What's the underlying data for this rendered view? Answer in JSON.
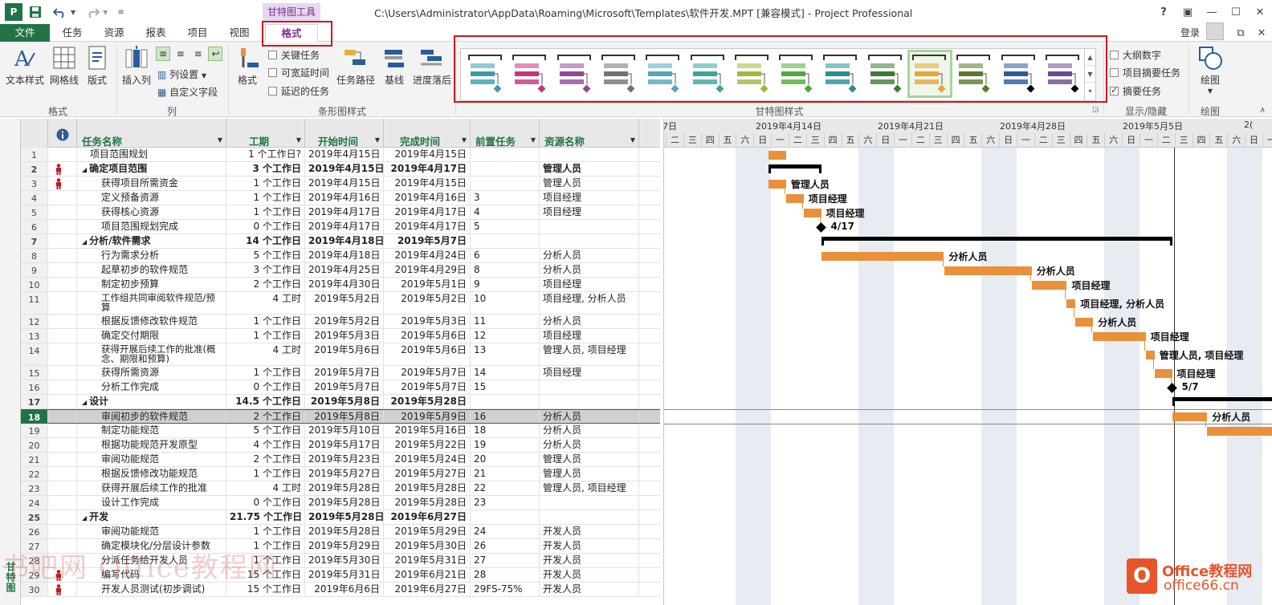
{
  "window": {
    "title": "C:\\Users\\Administrator\\AppData\\Roaming\\Microsoft\\Templates\\软件开发.MPT [兼容模式] - Project Professional",
    "context_tool": "甘特图工具",
    "help": "?",
    "login": "登录"
  },
  "tabs": [
    "文件",
    "任务",
    "资源",
    "报表",
    "项目",
    "视图",
    "格式"
  ],
  "ribbon": {
    "format_group": {
      "label": "格式",
      "text_styles": "文本样式",
      "gridlines": "网格线",
      "layout": "版式"
    },
    "columns_group": {
      "label": "列",
      "insert_column": "插入列",
      "column_settings": "列设置",
      "custom_fields": "自定义字段"
    },
    "bar_styles_group": {
      "label": "条形图样式",
      "format": "格式",
      "critical_tasks": "关键任务",
      "slack": "可宽延时间",
      "late_tasks": "延迟的任务",
      "task_path": "任务路径",
      "baseline": "基线",
      "slippage": "进度落后"
    },
    "gantt_styles_group": {
      "label": "甘特图样式"
    },
    "show_hide_group": {
      "label": "显示/隐藏",
      "outline_number": "大纲数字",
      "project_summary": "项目摘要任务",
      "summary_tasks": "摘要任务"
    },
    "drawings_group": {
      "label": "绘图",
      "drawing": "绘图"
    }
  },
  "gallery_colors": [
    "#3a9ea8",
    "#c4367c",
    "#8e4a9a",
    "#737373",
    "#54a7b3",
    "#3aa69a",
    "#9fb83a",
    "#4ea93a",
    "#2b8f92",
    "#3d7a3a",
    "#e9a53a",
    "#5a7a28",
    "#2c5a9a",
    "#6d4a8f"
  ],
  "side_label": "甘特图",
  "grid_headers": [
    "任务名称",
    "工期",
    "开始时间",
    "完成时间",
    "前置任务",
    "资源名称"
  ],
  "tasks": [
    {
      "id": "1",
      "name": "项目范围规划",
      "dur": "1 个工作日?",
      "start": "2019年4月15日",
      "finish": "2019年4月15日",
      "pred": "",
      "res": ""
    },
    {
      "id": "2",
      "name": "确定项目范围",
      "dur": "3 个工作日",
      "start": "2019年4月15日",
      "finish": "2019年4月17日",
      "pred": "",
      "res": "管理人员"
    },
    {
      "id": "3",
      "name": "获得项目所需资金",
      "dur": "1 个工作日",
      "start": "2019年4月15日",
      "finish": "2019年4月15日",
      "pred": "",
      "res": "管理人员"
    },
    {
      "id": "4",
      "name": "定义预备资源",
      "dur": "1 个工作日",
      "start": "2019年4月16日",
      "finish": "2019年4月16日",
      "pred": "3",
      "res": "项目经理"
    },
    {
      "id": "5",
      "name": "获得核心资源",
      "dur": "1 个工作日",
      "start": "2019年4月17日",
      "finish": "2019年4月17日",
      "pred": "4",
      "res": "项目经理"
    },
    {
      "id": "6",
      "name": "项目范围规划完成",
      "dur": "0 个工作日",
      "start": "2019年4月17日",
      "finish": "2019年4月17日",
      "pred": "5",
      "res": ""
    },
    {
      "id": "7",
      "name": "分析/软件需求",
      "dur": "14 个工作日",
      "start": "2019年4月18日",
      "finish": "2019年5月7日",
      "pred": "",
      "res": ""
    },
    {
      "id": "8",
      "name": "行为需求分析",
      "dur": "5 个工作日",
      "start": "2019年4月18日",
      "finish": "2019年4月24日",
      "pred": "6",
      "res": "分析人员"
    },
    {
      "id": "9",
      "name": "起草初步的软件规范",
      "dur": "3 个工作日",
      "start": "2019年4月25日",
      "finish": "2019年4月29日",
      "pred": "8",
      "res": "分析人员"
    },
    {
      "id": "10",
      "name": "制定初步预算",
      "dur": "2 个工作日",
      "start": "2019年4月30日",
      "finish": "2019年5月1日",
      "pred": "9",
      "res": "项目经理"
    },
    {
      "id": "11",
      "name": "工作组共同审阅软件规范/预算",
      "dur": "4 工时",
      "start": "2019年5月2日",
      "finish": "2019年5月2日",
      "pred": "10",
      "res": "项目经理, 分析人员"
    },
    {
      "id": "12",
      "name": "根据反馈修改软件规范",
      "dur": "1 个工作日",
      "start": "2019年5月2日",
      "finish": "2019年5月3日",
      "pred": "11",
      "res": "分析人员"
    },
    {
      "id": "13",
      "name": "确定交付期限",
      "dur": "1 个工作日",
      "start": "2019年5月3日",
      "finish": "2019年5月6日",
      "pred": "12",
      "res": "项目经理"
    },
    {
      "id": "14",
      "name": "获得开展后续工作的批准(概念、期限和预算)",
      "dur": "4 工时",
      "start": "2019年5月6日",
      "finish": "2019年5月6日",
      "pred": "13",
      "res": "管理人员, 项目经理"
    },
    {
      "id": "15",
      "name": "获得所需资源",
      "dur": "1 个工作日",
      "start": "2019年5月7日",
      "finish": "2019年5月7日",
      "pred": "14",
      "res": "项目经理"
    },
    {
      "id": "16",
      "name": "分析工作完成",
      "dur": "0 个工作日",
      "start": "2019年5月7日",
      "finish": "2019年5月7日",
      "pred": "15",
      "res": ""
    },
    {
      "id": "17",
      "name": "设计",
      "dur": "14.5 个工作日",
      "start": "2019年5月8日",
      "finish": "2019年5月28日",
      "pred": "",
      "res": ""
    },
    {
      "id": "18",
      "name": "审阅初步的软件规范",
      "dur": "2 个工作日",
      "start": "2019年5月8日",
      "finish": "2019年5月9日",
      "pred": "16",
      "res": "分析人员"
    },
    {
      "id": "19",
      "name": "制定功能规范",
      "dur": "5 个工作日",
      "start": "2019年5月10日",
      "finish": "2019年5月16日",
      "pred": "18",
      "res": "分析人员"
    },
    {
      "id": "20",
      "name": "根据功能规范开发原型",
      "dur": "4 个工作日",
      "start": "2019年5月17日",
      "finish": "2019年5月22日",
      "pred": "19",
      "res": "分析人员"
    },
    {
      "id": "21",
      "name": "审阅功能规范",
      "dur": "2 个工作日",
      "start": "2019年5月23日",
      "finish": "2019年5月24日",
      "pred": "20",
      "res": "管理人员"
    },
    {
      "id": "22",
      "name": "根据反馈修改功能规范",
      "dur": "1 个工作日",
      "start": "2019年5月27日",
      "finish": "2019年5月27日",
      "pred": "21",
      "res": "管理人员"
    },
    {
      "id": "23",
      "name": "获得开展后续工作的批准",
      "dur": "4 工时",
      "start": "2019年5月28日",
      "finish": "2019年5月28日",
      "pred": "22",
      "res": "管理人员, 项目经理"
    },
    {
      "id": "24",
      "name": "设计工作完成",
      "dur": "0 个工作日",
      "start": "2019年5月28日",
      "finish": "2019年5月28日",
      "pred": "23",
      "res": ""
    },
    {
      "id": "25",
      "name": "开发",
      "dur": "21.75 个工作日",
      "start": "2019年5月28日",
      "finish": "2019年6月27日",
      "pred": "",
      "res": ""
    },
    {
      "id": "26",
      "name": "审阅功能规范",
      "dur": "1 个工作日",
      "start": "2019年5月28日",
      "finish": "2019年5月29日",
      "pred": "24",
      "res": "开发人员"
    },
    {
      "id": "27",
      "name": "确定模块化/分层设计参数",
      "dur": "1 个工作日",
      "start": "2019年5月29日",
      "finish": "2019年5月30日",
      "pred": "26",
      "res": "开发人员"
    },
    {
      "id": "28",
      "name": "分派任务给开发人员",
      "dur": "1 个工作日",
      "start": "2019年5月30日",
      "finish": "2019年5月31日",
      "pred": "27",
      "res": "开发人员"
    },
    {
      "id": "29",
      "name": "编写代码",
      "dur": "15 个工作日",
      "start": "2019年5月31日",
      "finish": "2019年6月21日",
      "pred": "28",
      "res": "开发人员"
    },
    {
      "id": "30",
      "name": "开发人员测试(初步调试)",
      "dur": "15 个工作日",
      "start": "2019年6月6日",
      "finish": "2019年6月27日",
      "pred": "29FS-75%",
      "res": "开发人员"
    }
  ],
  "timescale": {
    "weeks": [
      "7日",
      "2019年4月14日",
      "2019年4月21日",
      "2019年4月28日",
      "2019年5月5日",
      "2("
    ],
    "days": [
      "一",
      "二",
      "三",
      "四",
      "五",
      "六",
      "日"
    ]
  },
  "gantt": {
    "labels": [
      "管理人员",
      "项目经理",
      "项目经理",
      "4/17",
      "分析人员",
      "分析人员",
      "项目经理",
      "项目经理, 分析人员",
      "分析人员",
      "项目经理",
      "管理人员, 项目经理",
      "项目经理",
      "5/7",
      "分析人员"
    ],
    "bar_color": "#e8913a"
  },
  "watermark": "书吧网 Office教程网",
  "logo": {
    "line1": "Office教程网",
    "line2": "office66.cn"
  }
}
